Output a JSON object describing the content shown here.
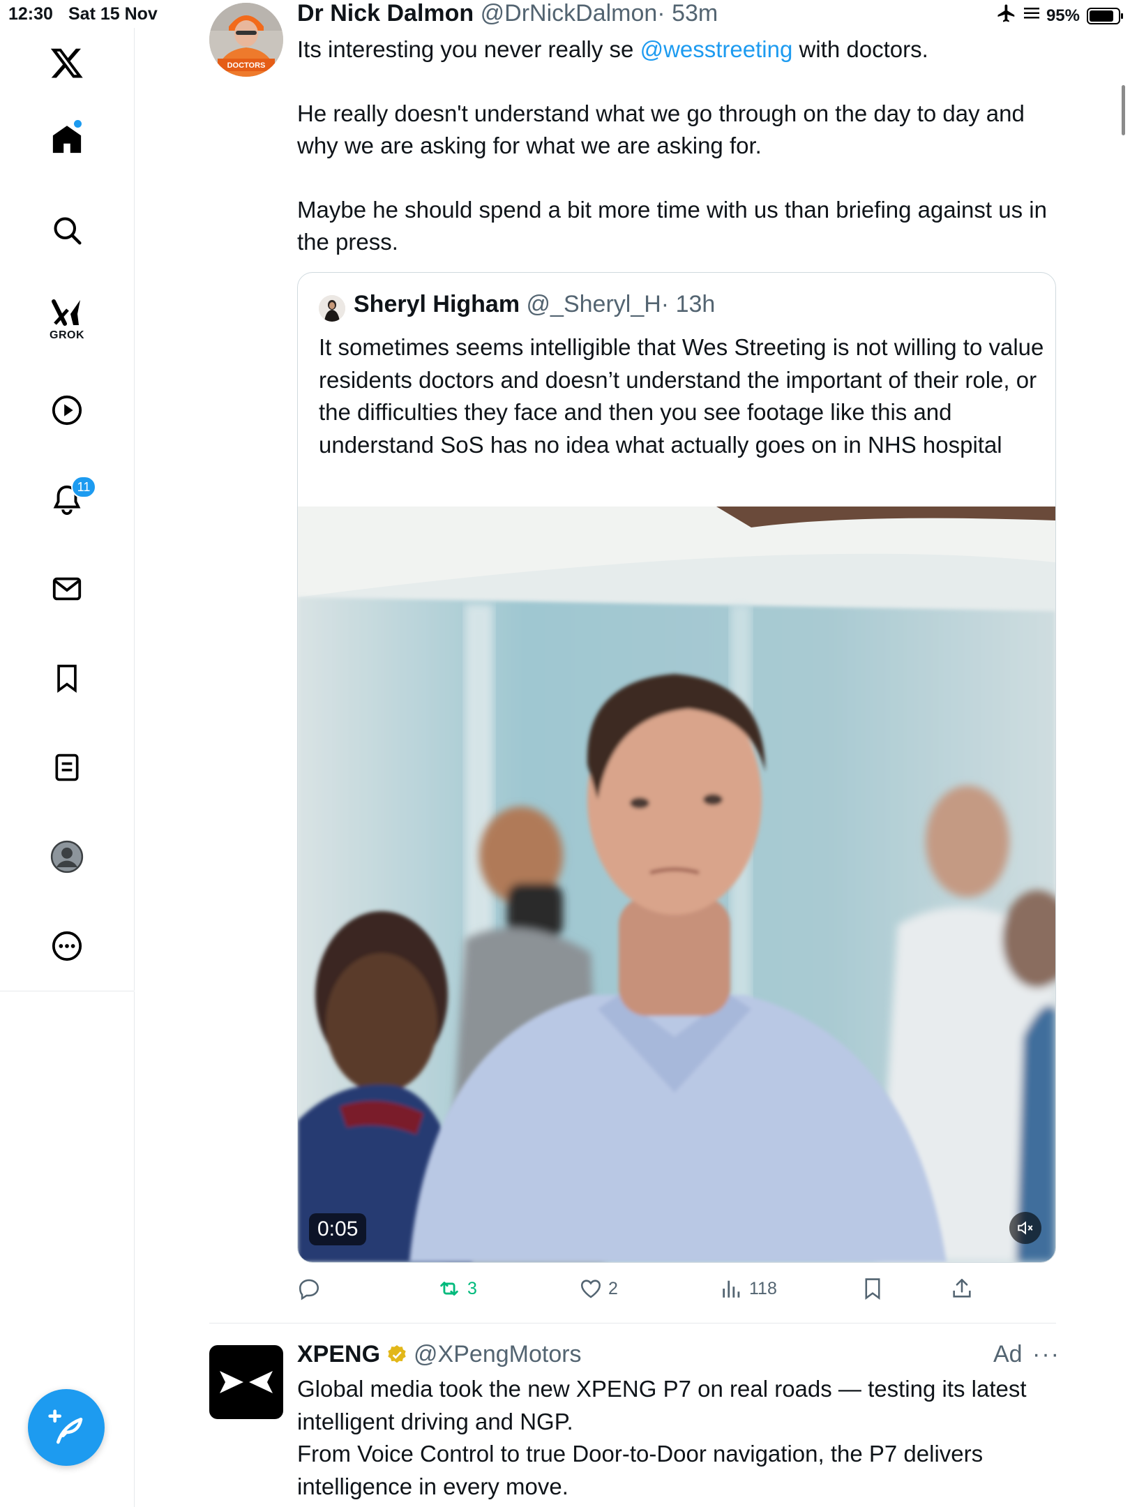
{
  "status_bar": {
    "time": "12:30",
    "date": "Sat 15 Nov",
    "battery": "95%",
    "battery_level": 0.95
  },
  "sidebar": {
    "logo": "x-logo-icon",
    "items": [
      {
        "name": "home",
        "icon": "home-icon",
        "has_dot": true
      },
      {
        "name": "search",
        "icon": "search-icon"
      },
      {
        "name": "grok",
        "icon": "grok-icon",
        "label": "GROK"
      },
      {
        "name": "video",
        "icon": "play-icon"
      },
      {
        "name": "notifications",
        "icon": "bell-icon",
        "badge": "11"
      },
      {
        "name": "messages",
        "icon": "mail-icon"
      },
      {
        "name": "bookmarks",
        "icon": "bookmark-icon"
      },
      {
        "name": "lists",
        "icon": "list-icon"
      },
      {
        "name": "profile",
        "icon": "profile-icon"
      },
      {
        "name": "more",
        "icon": "more-icon"
      }
    ],
    "compose_icon": "compose-icon"
  },
  "tweet": {
    "name": "Dr Nick Dalmon",
    "handle": "@DrNickDalmon",
    "time": "· 53m",
    "avatar_text": "DOCTORS",
    "text_p1_before": "Its interesting you never really se ",
    "text_p1_mention": "@wesstreeting",
    "text_p1_after": " with doctors.",
    "text_p2": "He really doesn't understand what we go through on the day to day and why we are asking for what we are asking for.",
    "text_p3": "Maybe he should spend a bit more time with us than briefing against us in the press.",
    "quote": {
      "name": "Sheryl Higham",
      "handle": "@_Sheryl_H",
      "time": "· 13h",
      "text": "It sometimes seems intelligible that Wes Streeting is not willing to value residents doctors and doesn’t understand the important of their role, or the difficulties they face and then you see footage like this and understand SoS has no idea what actually goes on in NHS hospital",
      "video_time": "0:05"
    },
    "actions": {
      "reply": "",
      "retweets": "3",
      "likes": "2",
      "views": "118"
    }
  },
  "ad_tweet": {
    "name": "XPENG",
    "handle": "@XPengMotors",
    "ad_label": "Ad",
    "more": "···",
    "line1": "Global media took the new XPENG P7 on real roads — testing its latest intelligent driving and NGP.",
    "line2": "From Voice Control to true Door-to-Door navigation, the P7 delivers intelligence in every move."
  }
}
